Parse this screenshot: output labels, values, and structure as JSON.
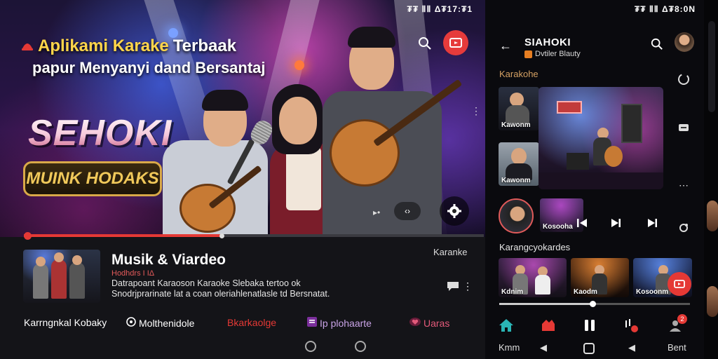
{
  "left_status": "₮₮ ⅡⅡ Δ₮17:₮1",
  "hero": {
    "title_part1": "Aplikami Karake",
    "title_part2": "Terbaak",
    "subtitle": "papur Menyanyi dand Bersantaj",
    "brand": "SEHOKI",
    "badge": "MUINK HODAKS",
    "ctrl_label": "‹›",
    "playback_fraction": 0.43
  },
  "card": {
    "title": "Musik & Viardeo",
    "tag": "Karanke",
    "meta": "Hodhdrs I IΔ",
    "description": "Datrapoant Karaoson Karaoke Slebaka tertoo ok\nSnodrjprarinate lat a coan oleriahlenatlasle td Bersnatat.",
    "overflow": "⋮"
  },
  "bottom_nav": [
    {
      "label": "Karrngnkal Kobaky",
      "icon": "",
      "color": "#ffffff"
    },
    {
      "label": "Molthenidole",
      "icon": "disc-icon",
      "color": "#ffffff"
    },
    {
      "label": "Bkarkaolge",
      "icon": "",
      "color": "#e53935"
    },
    {
      "label": "Ip plohaarte",
      "icon": "playlist-icon",
      "color": "#c9a3e6"
    },
    {
      "label": "Uaras",
      "icon": "heart-icon",
      "color": "#e35a7a"
    }
  ],
  "right_status": "₮₮ ⅡⅡ Δ₮8:0N",
  "right": {
    "title": "SIAHOKI",
    "subtitle": "Dvtiler Blauty",
    "section1": "Karakohe",
    "thumb1_label": "Kawonm",
    "thumb2_label": "Kawonm",
    "mini_label": "Kosooha",
    "section2": "Karangcyokardes",
    "row": [
      {
        "label": "Kdnim"
      },
      {
        "label": "Kaodm"
      },
      {
        "label": "Kosoonm"
      }
    ],
    "scrub_fraction": 0.49,
    "tabs_left_label": "Kmm",
    "tabs_right_label": "Bent",
    "badge_count": "2"
  },
  "colors": {
    "accent_red": "#e53935",
    "gold": "#d9a948",
    "section_gold": "#d4a063"
  }
}
